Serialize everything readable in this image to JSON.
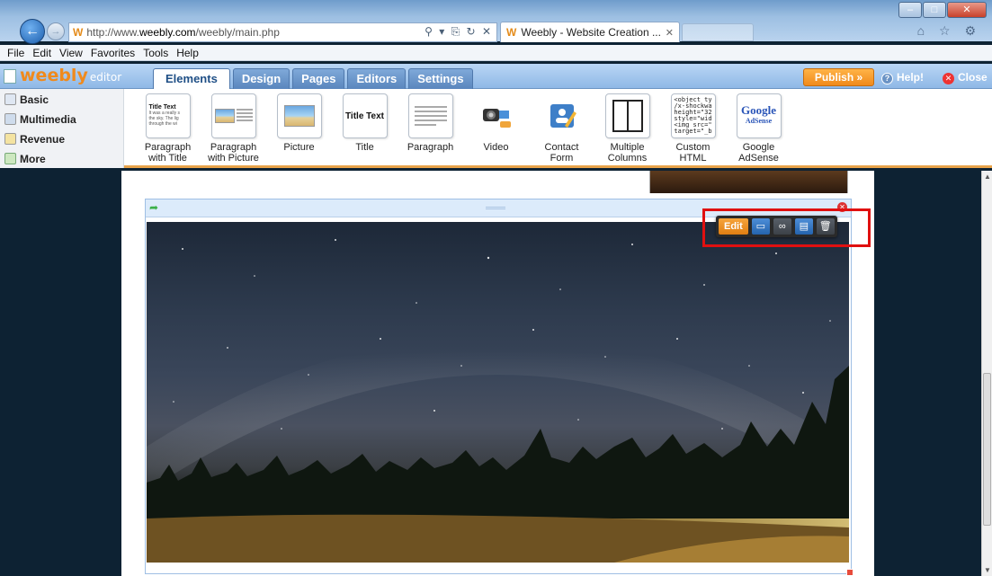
{
  "browser": {
    "window_title": "",
    "back_icon": "back-arrow-icon",
    "forward_icon": "forward-arrow-icon",
    "url_prefix": "http://www.",
    "url_domain": "weebly.com",
    "url_suffix": "/weebly/main.php",
    "address_controls": "⚲ ▾ ⎘ ↻ ✕",
    "tab_title": "Weebly - Website Creation ...",
    "tab_close": "✕",
    "site_logo_letter": "W",
    "right_icons": "⌂ ☆ ⚙"
  },
  "menu": [
    "File",
    "Edit",
    "View",
    "Favorites",
    "Tools",
    "Help"
  ],
  "editor": {
    "logo": "weebly",
    "logo_suffix": "editor",
    "tabs": [
      "Elements",
      "Design",
      "Pages",
      "Editors",
      "Settings"
    ],
    "active_tab": "Elements",
    "publish_label": "Publish »",
    "help_label": "Help!",
    "close_label": "Close",
    "accent_color": "#f08a1c"
  },
  "categories": [
    "Basic",
    "Multimedia",
    "Revenue",
    "More"
  ],
  "elements": [
    {
      "line1": "Paragraph",
      "line2": "with Title",
      "preview_title": "Title Text",
      "preview_body": "It was a really s the sky. The lig through the wi"
    },
    {
      "line1": "Paragraph",
      "line2": "with Picture"
    },
    {
      "line1": "Picture",
      "line2": ""
    },
    {
      "line1": "Title",
      "line2": "",
      "preview_title": "Title Text"
    },
    {
      "line1": "Paragraph",
      "line2": ""
    },
    {
      "line1": "Video",
      "line2": ""
    },
    {
      "line1": "Contact",
      "line2": "Form"
    },
    {
      "line1": "Multiple",
      "line2": "Columns"
    },
    {
      "line1": "Custom",
      "line2": "HTML",
      "preview_code": "<object ty\n/x-shockwa\nheight=\"32\nstyle=\"wid\n<img src=\"\ntarget=\"_b"
    },
    {
      "line1": "Google",
      "line2": "AdSense",
      "preview_brand": "Google",
      "preview_sub": "AdSense"
    }
  ],
  "image_toolbar": {
    "edit_label": "Edit",
    "buttons": [
      "image-settings-icon",
      "link-icon",
      "caption-icon",
      "trash-icon"
    ]
  }
}
